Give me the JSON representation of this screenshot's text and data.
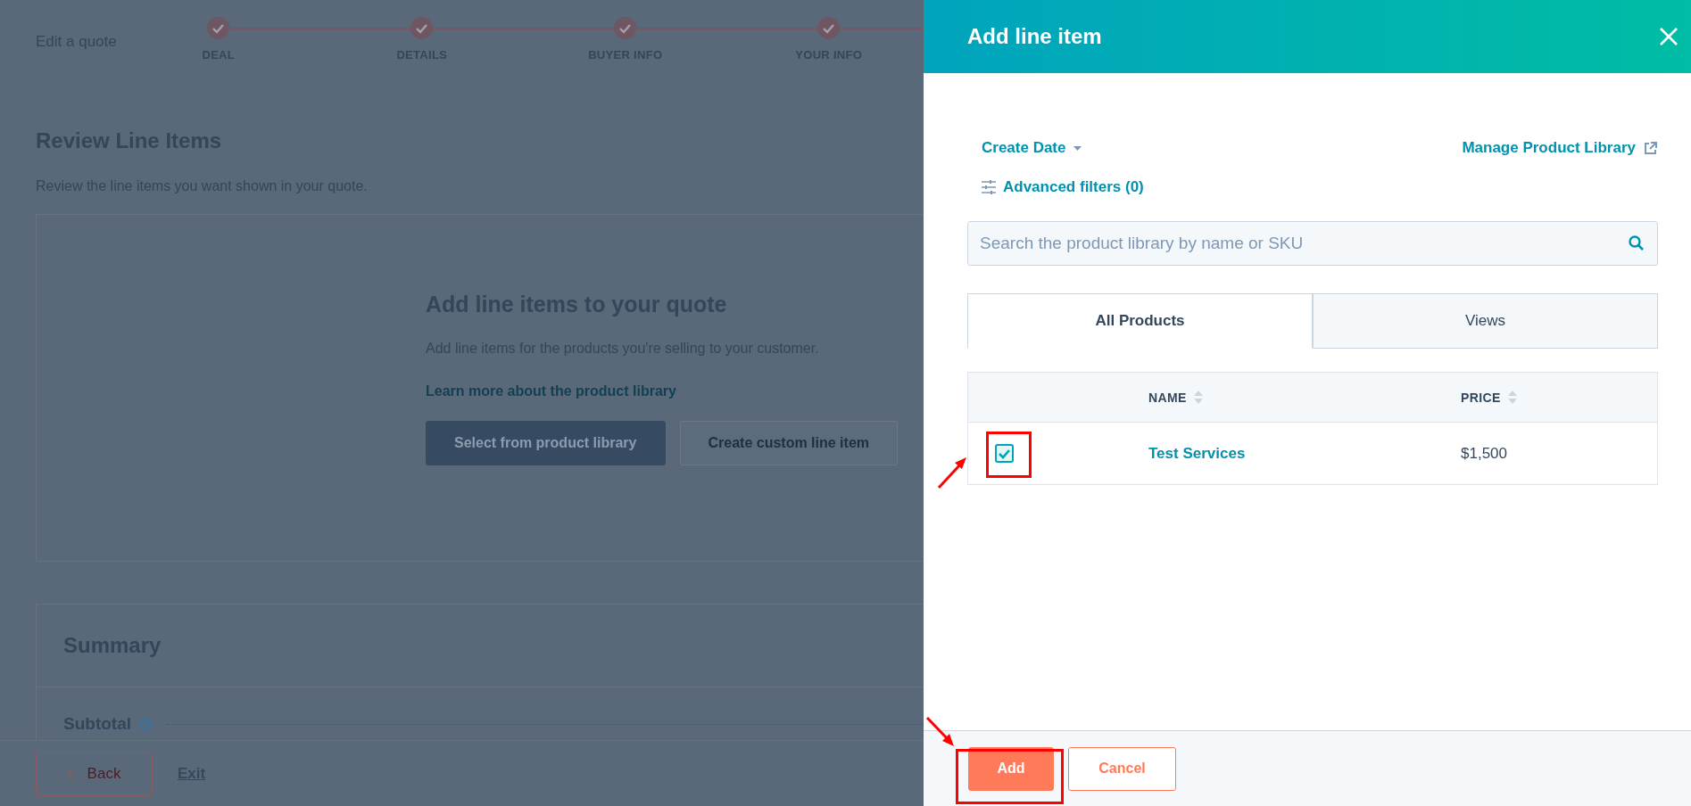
{
  "background_page": {
    "title": "Edit a quote",
    "steps": [
      {
        "label": "DEAL",
        "completed": true
      },
      {
        "label": "DETAILS",
        "completed": true
      },
      {
        "label": "BUYER INFO",
        "completed": true
      },
      {
        "label": "YOUR INFO",
        "completed": true
      }
    ],
    "heading": "Review Line Items",
    "description": "Review the line items you want shown in your quote.",
    "empty_state": {
      "title": "Add line items to your quote",
      "text": "Add line items for the products you're selling to your customer.",
      "link": "Learn more about the product library",
      "buttons": [
        {
          "label": "Select from product library",
          "kind": "primary"
        },
        {
          "label": "Create custom line item",
          "kind": "secondary"
        }
      ]
    },
    "summary": {
      "title": "Summary",
      "rows": [
        {
          "label": "Subtotal"
        }
      ]
    },
    "footer": {
      "back": "Back",
      "exit": "Exit"
    }
  },
  "panel": {
    "title": "Add line item",
    "sort": "Create Date",
    "manage_link": "Manage Product Library",
    "filters": "Advanced filters (0)",
    "search": {
      "placeholder": "Search the product library by name or SKU"
    },
    "tabs": [
      {
        "label": "All Products",
        "selected": true
      },
      {
        "label": "Views",
        "selected": false
      }
    ],
    "table": {
      "columns": [
        "NAME",
        "PRICE"
      ],
      "rows": [
        {
          "checked": true,
          "name": "Test Services",
          "price": "$1,500"
        }
      ]
    },
    "buttons": [
      {
        "label": "Add",
        "kind": "primary"
      },
      {
        "label": "Cancel",
        "kind": "secondary"
      }
    ]
  }
}
